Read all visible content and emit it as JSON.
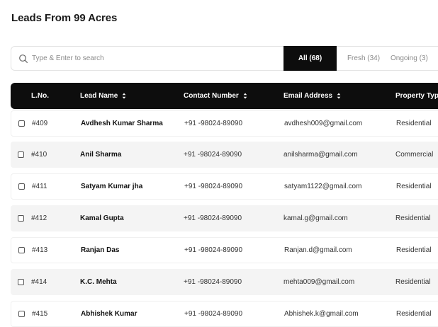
{
  "page": {
    "title": "Leads From 99 Acres"
  },
  "search": {
    "placeholder": "Type & Enter to search",
    "value": ""
  },
  "filters": [
    {
      "label": "All (68)",
      "active": true
    },
    {
      "label": "Fresh (34)",
      "active": false
    },
    {
      "label": "Ongoing (3)",
      "active": false
    }
  ],
  "table": {
    "headers": {
      "lno": "L.No.",
      "name": "Lead Name",
      "contact": "Contact Number",
      "email": "Email Address",
      "type": "Property Type"
    },
    "rows": [
      {
        "lno": "#409",
        "name": "Avdhesh Kumar Sharma",
        "contact": "+91 -98024-89090",
        "email": "avdhesh009@gmail.com",
        "type": "Residential"
      },
      {
        "lno": "#410",
        "name": "Anil Sharma",
        "contact": "+91 -98024-89090",
        "email": "anilsharma@gmail.com",
        "type": "Commercial"
      },
      {
        "lno": "#411",
        "name": "Satyam Kumar jha",
        "contact": "+91 -98024-89090",
        "email": "satyam1122@gmail.com",
        "type": "Residential"
      },
      {
        "lno": "#412",
        "name": "Kamal Gupta",
        "contact": "+91 -98024-89090",
        "email": "kamal.g@gmail.com",
        "type": "Residential"
      },
      {
        "lno": "#413",
        "name": "Ranjan Das",
        "contact": "+91 -98024-89090",
        "email": "Ranjan.d@gmail.com",
        "type": "Residential"
      },
      {
        "lno": "#414",
        "name": "K.C. Mehta",
        "contact": "+91 -98024-89090",
        "email": "mehta009@gmail.com",
        "type": "Residential"
      },
      {
        "lno": "#415",
        "name": "Abhishek Kumar",
        "contact": "+91 -98024-89090",
        "email": "Abhishek.k@gmail.com",
        "type": "Residential"
      }
    ]
  },
  "colors": {
    "header_bg": "#0d0d0d",
    "row_alt_bg": "#f4f4f4",
    "muted_text": "#8a8a8a"
  }
}
